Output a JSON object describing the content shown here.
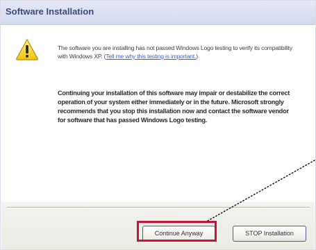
{
  "window": {
    "title": "Software Installation"
  },
  "message": {
    "line1_prefix": "The software you are installing has not passed Windows Logo testing to verify its compatibility with Windows XP. (",
    "link_text": "Tell me why this testing is important.",
    "line1_suffix": ")",
    "warning": "Continuing your installation of this software may impair or destabilize the correct operation of your system either immediately or in the future. Microsoft strongly recommends that you stop this installation now and contact the software vendor for software that has passed Windows Logo testing."
  },
  "buttons": {
    "continue_label": "Continue Anyway",
    "stop_label": "STOP Installation"
  },
  "icons": {
    "warning": "warning-icon"
  },
  "colors": {
    "highlight": "#c4143a",
    "link": "#3a5fcd",
    "title_text": "#3b4a7c"
  }
}
